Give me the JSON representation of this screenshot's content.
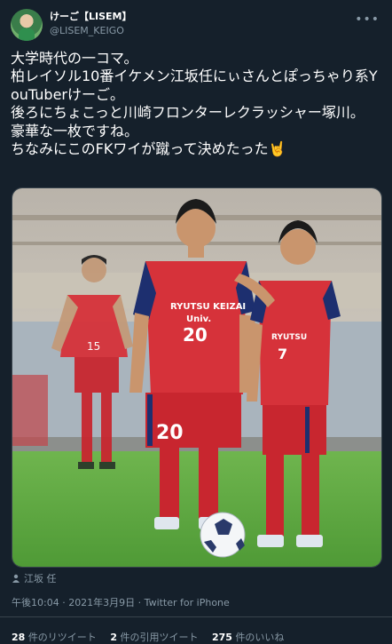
{
  "author": {
    "display_name": "けーご【LISEM】",
    "handle": "@LISEM_KEIGO",
    "avatar_icon": "user-avatar-icon"
  },
  "more_icon": "more-options-icon",
  "tweet_text": "大学時代の一コマ。\n柏レイソル10番イケメン江坂任にぃさんとぽっちゃり系YouTuberけーご。\n後ろにちょこっと川崎フロンターレクラッシャー塚川。\n豪華な一枚ですね。\nちなみにこのFKワイが蹴って決めたった🤘",
  "photo": {
    "jersey_text_1": "RYUTSU KEIZAI",
    "jersey_text_2": "Univ.",
    "number_left_player": "20",
    "number_right_player": "7",
    "number_back_player": "15"
  },
  "tagged_user": "江坂 任",
  "timestamp": "午後10:04 · 2021年3月9日 · Twitter for iPhone",
  "stats": {
    "retweets_count": "28",
    "retweets_label": "件のリツイート",
    "quotes_count": "2",
    "quotes_label": "件の引用ツイート",
    "likes_count": "275",
    "likes_label": "件のいいね"
  },
  "colors": {
    "background": "#15202b",
    "secondary_text": "#8899a6",
    "jersey_red": "#d6323a",
    "jersey_navy": "#1d2f6f"
  }
}
